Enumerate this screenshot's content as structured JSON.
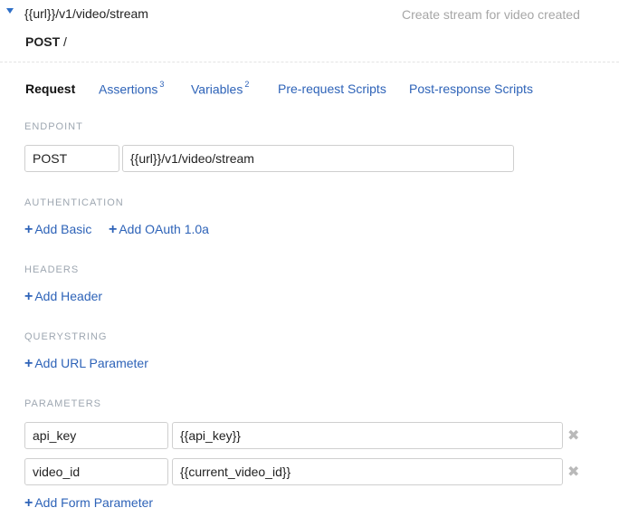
{
  "request": {
    "url": "{{url}}/v1/video/stream",
    "description": "Create stream for video created",
    "method": "POST",
    "separator": "/"
  },
  "tabs": [
    {
      "label": "Request",
      "badge": ""
    },
    {
      "label": "Assertions",
      "badge": "3"
    },
    {
      "label": "Variables",
      "badge": "2"
    },
    {
      "label": "Pre-request Scripts",
      "badge": ""
    },
    {
      "label": "Post-response Scripts",
      "badge": ""
    }
  ],
  "endpoint": {
    "label": "ENDPOINT",
    "method": "POST",
    "url": "{{url}}/v1/video/stream"
  },
  "authentication": {
    "label": "AUTHENTICATION",
    "add_basic": "Add Basic",
    "add_oauth": "Add OAuth 1.0a"
  },
  "headers": {
    "label": "HEADERS",
    "add": "Add Header"
  },
  "querystring": {
    "label": "QUERYSTRING",
    "add": "Add URL Parameter"
  },
  "parameters": {
    "label": "PARAMETERS",
    "rows": [
      {
        "key": "api_key",
        "value": "{{api_key}}"
      },
      {
        "key": "video_id",
        "value": "{{current_video_id}}"
      }
    ],
    "add": "Add Form Parameter"
  },
  "icons": {
    "plus": "+",
    "remove": "✖"
  },
  "colors": {
    "link": "#2e63b8",
    "section_label": "#9ea7b1",
    "muted": "#a6a6a6"
  }
}
